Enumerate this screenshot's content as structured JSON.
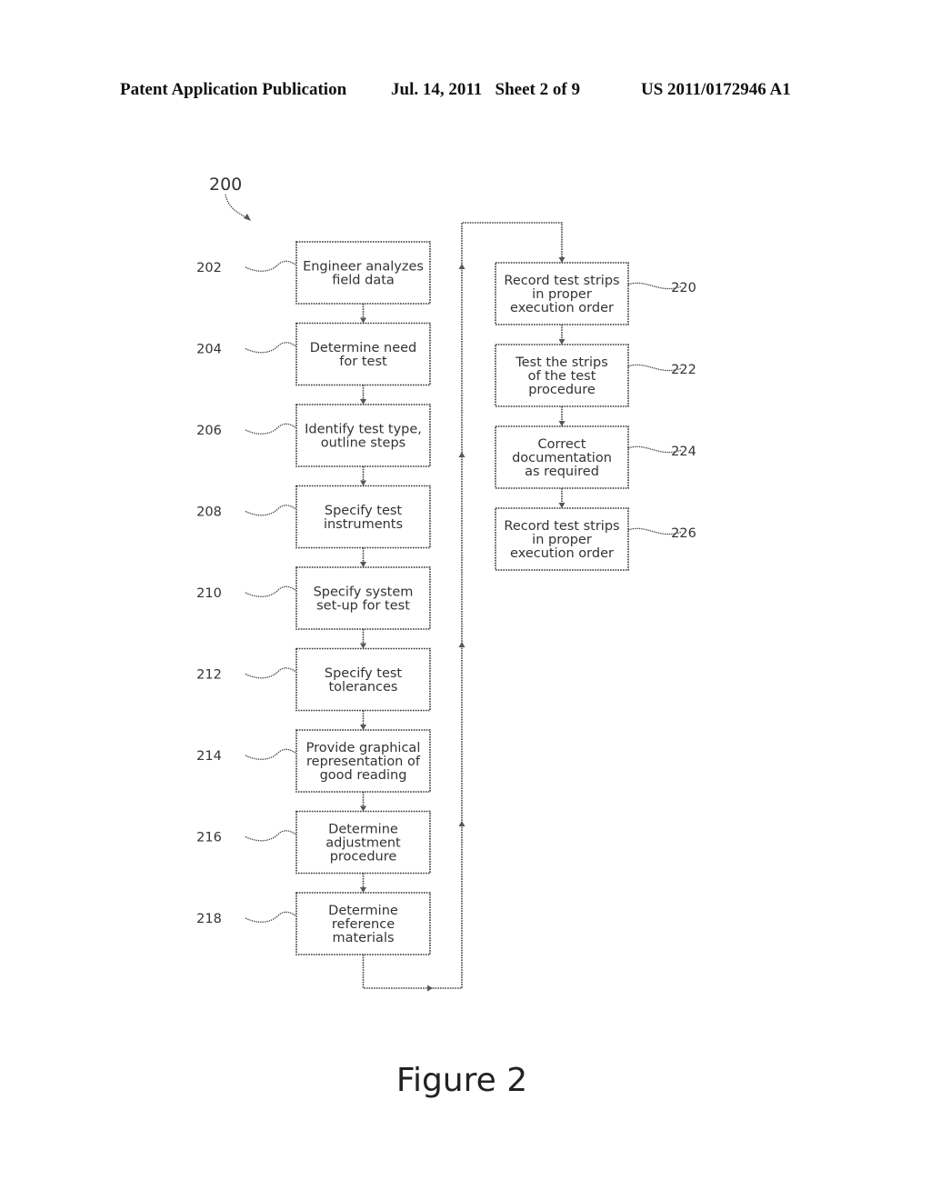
{
  "header": {
    "left": "Patent Application Publication",
    "middle": "Jul. 14, 2011   Sheet 2 of 9",
    "right": "US 2011/0172946 A1"
  },
  "figure": {
    "ref": "200",
    "caption": "Figure 2",
    "steps": [
      {
        "ref": "202",
        "lines": [
          "Engineer analyzes",
          "field data"
        ],
        "column": "left"
      },
      {
        "ref": "204",
        "lines": [
          "Determine need",
          "for test"
        ],
        "column": "left"
      },
      {
        "ref": "206",
        "lines": [
          "Identify test type,",
          "outline steps"
        ],
        "column": "left"
      },
      {
        "ref": "208",
        "lines": [
          "Specify test",
          "instruments"
        ],
        "column": "left"
      },
      {
        "ref": "210",
        "lines": [
          "Specify system",
          "set-up for test"
        ],
        "column": "left"
      },
      {
        "ref": "212",
        "lines": [
          "Specify test",
          "tolerances"
        ],
        "column": "left"
      },
      {
        "ref": "214",
        "lines": [
          "Provide graphical",
          "representation of",
          "good reading"
        ],
        "column": "left"
      },
      {
        "ref": "216",
        "lines": [
          "Determine",
          "adjustment",
          "procedure"
        ],
        "column": "left"
      },
      {
        "ref": "218",
        "lines": [
          "Determine",
          "reference",
          "materials"
        ],
        "column": "left"
      },
      {
        "ref": "220",
        "lines": [
          "Record test strips",
          "in proper",
          "execution order"
        ],
        "column": "right"
      },
      {
        "ref": "222",
        "lines": [
          "Test the strips",
          "of the test",
          "procedure"
        ],
        "column": "right"
      },
      {
        "ref": "224",
        "lines": [
          "Correct",
          "documentation",
          "as required"
        ],
        "column": "right"
      },
      {
        "ref": "226",
        "lines": [
          "Record test strips",
          "in proper",
          "execution order"
        ],
        "column": "right"
      }
    ]
  }
}
